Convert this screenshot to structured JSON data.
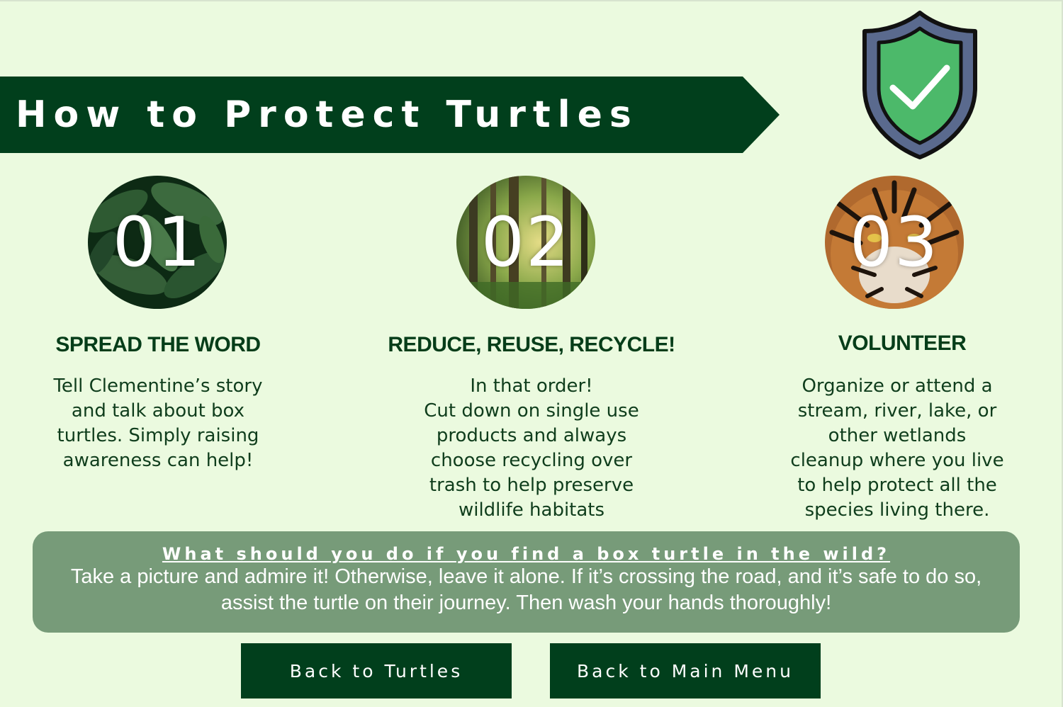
{
  "header": {
    "title": "How to Protect Turtles",
    "banner_color": "#013f1c",
    "shield_icon": "shield-check-icon"
  },
  "steps": [
    {
      "number": "01",
      "image": "leaves-image",
      "heading": "SPREAD THE WORD",
      "text": "Tell Clementine’s story\nand talk about box\nturtles. Simply raising\nawareness can help!"
    },
    {
      "number": "02",
      "image": "forest-image",
      "heading": "REDUCE, REUSE, RECYCLE!",
      "text": "In that order!\nCut down on single use\nproducts and always\nchoose recycling over\ntrash to help preserve\nwildlife habitats"
    },
    {
      "number": "03",
      "image": "tiger-image",
      "heading": "VOLUNTEER",
      "text": "Organize or attend a\nstream, river, lake, or\nother wetlands\ncleanup where you live\nto help protect all the\nspecies living there."
    }
  ],
  "info": {
    "question": "What should you do if you find a box turtle in the wild?",
    "answer": "Take a picture and admire it! Otherwise, leave it alone. If it’s crossing the road, and it’s safe to do so, assist the turtle on their journey. Then wash your hands thoroughly!"
  },
  "buttons": {
    "back_turtles": "Back to Turtles",
    "back_menu": "Back to Main Menu"
  },
  "colors": {
    "background": "#ebfadf",
    "heading_green": "#063d19",
    "info_box": "#779b79",
    "shield_green": "#4cb96a",
    "shield_border": "#5a6a8e"
  }
}
